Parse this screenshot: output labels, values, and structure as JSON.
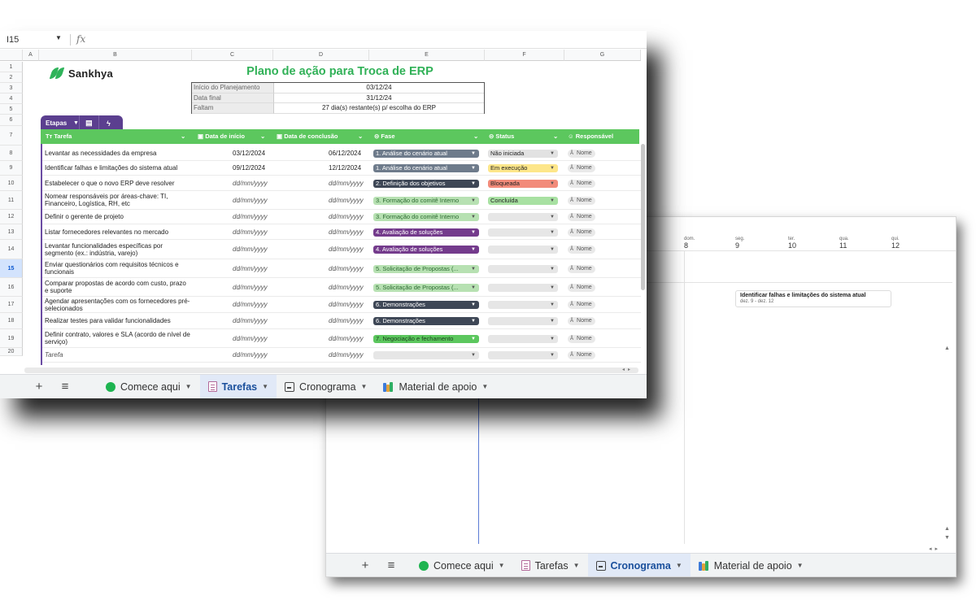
{
  "formula_bar": {
    "cell_ref": "I15",
    "fx": "fx"
  },
  "columns": [
    "A",
    "B",
    "C",
    "D",
    "E",
    "F",
    "G"
  ],
  "row_numbers": [
    "1",
    "2",
    "3",
    "4",
    "5",
    "6",
    "7",
    "8",
    "9",
    "10",
    "11",
    "12",
    "13",
    "14",
    "15",
    "16",
    "17",
    "18",
    "19",
    "20"
  ],
  "selected_row": "15",
  "logo": {
    "text": "Sankhya"
  },
  "title": "Plano de ação para Troca de ERP",
  "info": [
    {
      "label": "Início do Planejamento",
      "value": "03/12/24"
    },
    {
      "label": "Data final",
      "value": "31/12/24"
    },
    {
      "label": "Faltam",
      "value": "27 dia(s) restante(s) p/ escolha do ERP"
    }
  ],
  "etapas": {
    "label": "Etapas"
  },
  "table_headers": {
    "tarefa": "Tarefa",
    "inicio": "Data de início",
    "conclusao": "Data de conclusão",
    "fase": "Fase",
    "status": "Status",
    "responsavel": "Responsável"
  },
  "rows": [
    {
      "task": "Levantar as necessidades da empresa",
      "start": "03/12/2024",
      "end": "06/12/2024",
      "phase": "1. Análise do cenário atual",
      "status": "Não iniciada",
      "owner": "Nome"
    },
    {
      "task": "Identificar falhas e limitações do sistema atual",
      "start": "09/12/2024",
      "end": "12/12/2024",
      "phase": "1. Análise do cenário atual",
      "status": "Em execução",
      "owner": "Nome"
    },
    {
      "task": "Estabelecer o que o novo ERP deve resolver",
      "start": "dd/mm/yyyy",
      "end": "dd/mm/yyyy",
      "phase": "2. Definição dos objetivos",
      "status": "Bloqueada",
      "owner": "Nome"
    },
    {
      "task": "Nomear responsáveis por áreas-chave: TI, Financeiro, Logística, RH, etc",
      "start": "dd/mm/yyyy",
      "end": "dd/mm/yyyy",
      "phase": "3. Formação do comitê Interno",
      "status": "Concluída",
      "owner": "Nome"
    },
    {
      "task": "Definir o gerente de projeto",
      "start": "dd/mm/yyyy",
      "end": "dd/mm/yyyy",
      "phase": "3. Formação do comitê Interno",
      "status": "",
      "owner": "Nome"
    },
    {
      "task": "Listar fornecedores relevantes no mercado",
      "start": "dd/mm/yyyy",
      "end": "dd/mm/yyyy",
      "phase": "4. Avaliação de soluções",
      "status": "",
      "owner": "Nome"
    },
    {
      "task": "Levantar funcionalidades específicas por segmento (ex.: indústria, varejo)",
      "start": "dd/mm/yyyy",
      "end": "dd/mm/yyyy",
      "phase": "4. Avaliação de soluções",
      "status": "",
      "owner": "Nome"
    },
    {
      "task": "Enviar questionários com requisitos técnicos e funcionais",
      "start": "dd/mm/yyyy",
      "end": "dd/mm/yyyy",
      "phase": "5. Solicitação de Propostas (...",
      "status": "",
      "owner": "Nome"
    },
    {
      "task": "Comparar propostas de acordo com custo, prazo e suporte",
      "start": "dd/mm/yyyy",
      "end": "dd/mm/yyyy",
      "phase": "5. Solicitação de Propostas (...",
      "status": "",
      "owner": "Nome"
    },
    {
      "task": "Agendar apresentações com os fornecedores pré-selecionados",
      "start": "dd/mm/yyyy",
      "end": "dd/mm/yyyy",
      "phase": "6. Demonstrações",
      "status": "",
      "owner": "Nome"
    },
    {
      "task": "Realizar testes para validar funcionalidades",
      "start": "dd/mm/yyyy",
      "end": "dd/mm/yyyy",
      "phase": "6. Demonstrações",
      "status": "",
      "owner": "Nome"
    },
    {
      "task": "Definir contrato, valores e SLA (acordo de nível de serviço)",
      "start": "dd/mm/yyyy",
      "end": "dd/mm/yyyy",
      "phase": "7. Negociação e fechamento",
      "status": "",
      "owner": "Nome"
    },
    {
      "task": "Tarefa",
      "start": "dd/mm/yyyy",
      "end": "dd/mm/yyyy",
      "phase": "",
      "status": "",
      "owner": "Nome"
    }
  ],
  "phase_colors": {
    "1": "#6e7b8b",
    "2": "#3e4756",
    "3": "#b7e1b2",
    "4": "#743b8c",
    "5": "#b7e1b2",
    "6": "#3e4756",
    "7": "#5cc75e"
  },
  "status_colors": {
    "Não iniciada": "#e2e2e2",
    "Em execução": "#fde68a",
    "Bloqueada": "#f28b7a",
    "Concluída": "#a8e1a2"
  },
  "sheet_tabs_front": [
    {
      "label": "Comece aqui",
      "icon": "green-dot-icon",
      "active": false
    },
    {
      "label": "Tarefas",
      "icon": "document-icon",
      "active": true
    },
    {
      "label": "Cronograma",
      "icon": "timeline-icon",
      "active": false
    },
    {
      "label": "Material de apoio",
      "icon": "books-icon",
      "active": false
    }
  ],
  "sheet_tabs_back": [
    {
      "label": "Comece aqui",
      "icon": "green-dot-icon",
      "active": false
    },
    {
      "label": "Tarefas",
      "icon": "document-icon",
      "active": false
    },
    {
      "label": "Cronograma",
      "icon": "timeline-icon",
      "active": true
    },
    {
      "label": "Material de apoio",
      "icon": "books-icon",
      "active": false
    }
  ],
  "timeline": {
    "days": [
      {
        "name": "dom.",
        "num": "8"
      },
      {
        "name": "seg.",
        "num": "9"
      },
      {
        "name": "ter.",
        "num": "10"
      },
      {
        "name": "qua.",
        "num": "11"
      },
      {
        "name": "qui.",
        "num": "12"
      }
    ],
    "card": {
      "title": "Identificar falhas e limitações do sistema atual",
      "range": "dez. 9 - dez. 12"
    }
  }
}
